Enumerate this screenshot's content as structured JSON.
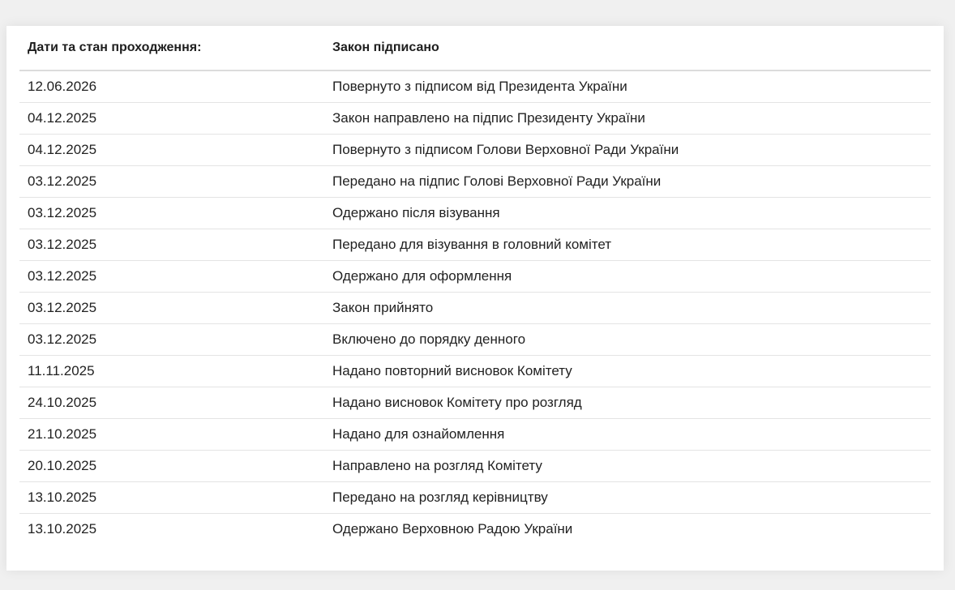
{
  "table": {
    "header": {
      "col1": "Дати та стан проходження:",
      "col2": "Закон підписано"
    },
    "rows": [
      {
        "date": "12.06.2026",
        "status": "Повернуто з підписом від Президента України"
      },
      {
        "date": "04.12.2025",
        "status": "Закон направлено на підпис Президенту України"
      },
      {
        "date": "04.12.2025",
        "status": "Повернуто з підписом Голови Верховної Ради України"
      },
      {
        "date": "03.12.2025",
        "status": "Передано на підпис Голові Верховної Ради України"
      },
      {
        "date": "03.12.2025",
        "status": "Одержано після візування"
      },
      {
        "date": "03.12.2025",
        "status": "Передано для візування в головний комітет"
      },
      {
        "date": "03.12.2025",
        "status": "Одержано для оформлення"
      },
      {
        "date": "03.12.2025",
        "status": "Закон прийнято"
      },
      {
        "date": "03.12.2025",
        "status": "Включено до порядку денного"
      },
      {
        "date": "11.11.2025",
        "status": "Надано повторний висновок Комітету"
      },
      {
        "date": "24.10.2025",
        "status": "Надано висновок Комітету про розгляд"
      },
      {
        "date": "21.10.2025",
        "status": "Надано для ознайомлення"
      },
      {
        "date": "20.10.2025",
        "status": "Направлено на розгляд Комітету"
      },
      {
        "date": "13.10.2025",
        "status": "Передано на розгляд керівництву"
      },
      {
        "date": "13.10.2025",
        "status": "Одержано Верховною Радою України"
      }
    ]
  }
}
